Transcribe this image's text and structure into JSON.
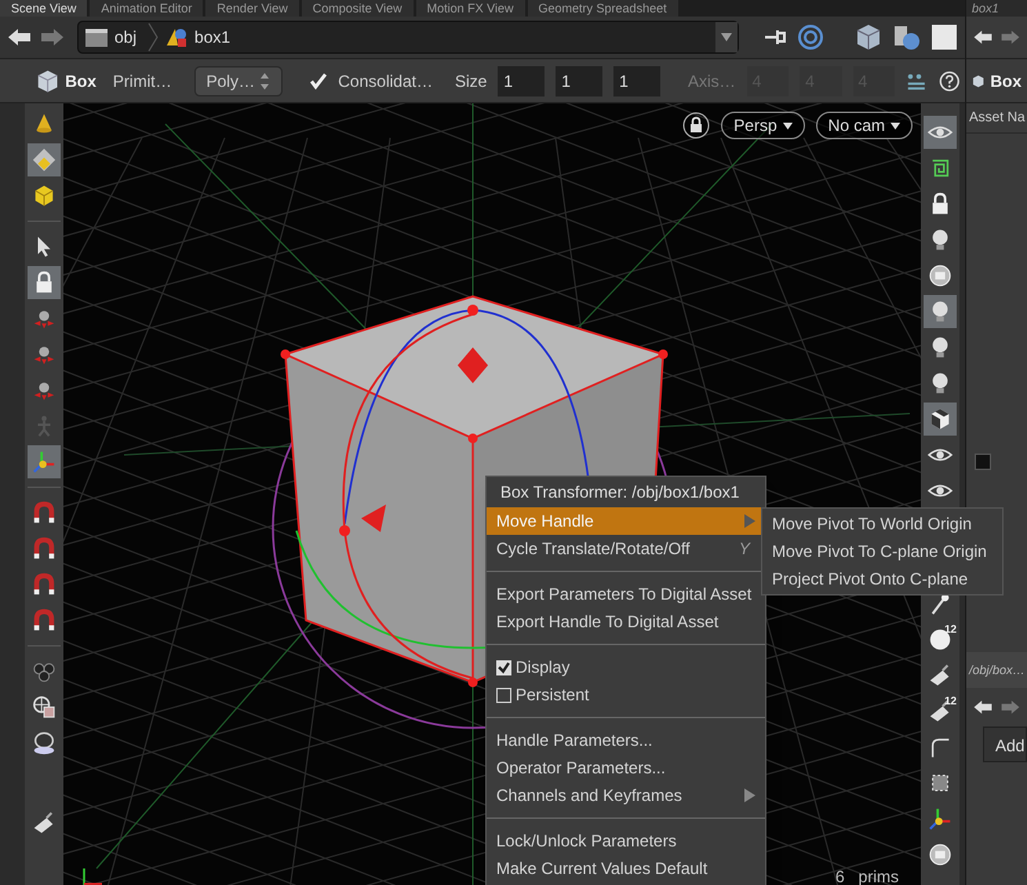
{
  "tabs": [
    {
      "label": "Scene View",
      "selected": true
    },
    {
      "label": "Animation Editor",
      "selected": false
    },
    {
      "label": "Render View",
      "selected": false
    },
    {
      "label": "Composite View",
      "selected": false
    },
    {
      "label": "Motion FX View",
      "selected": false
    },
    {
      "label": "Geometry Spreadsheet",
      "selected": false
    }
  ],
  "path": [
    "obj",
    "box1"
  ],
  "operator_bar": {
    "name": "Box",
    "primitive_label": "Primit…",
    "primitive_type": "Poly…",
    "consolidate": {
      "label": "Consolidat…",
      "checked": true
    },
    "size_label": "Size",
    "size": [
      "1",
      "1",
      "1"
    ],
    "axis_label": "Axis…",
    "axis": [
      "4",
      "4",
      "4"
    ]
  },
  "viewport": {
    "camera": "Persp",
    "cam_menu": "No cam",
    "status": "6   prims"
  },
  "left_tools": [
    {
      "kind": "cone",
      "selected": false
    },
    {
      "kind": "diamond",
      "selected": true
    },
    {
      "kind": "cube",
      "selected": false
    },
    {
      "kind": "separator"
    },
    {
      "kind": "arrow",
      "selected": false
    },
    {
      "kind": "lock",
      "selected": true
    },
    {
      "kind": "handle",
      "selected": false
    },
    {
      "kind": "handle",
      "selected": false
    },
    {
      "kind": "handle",
      "selected": false
    },
    {
      "kind": "figure",
      "selected": false
    },
    {
      "kind": "axes",
      "selected": true
    },
    {
      "kind": "separator"
    },
    {
      "kind": "magnet",
      "selected": false
    },
    {
      "kind": "magnet",
      "selected": false
    },
    {
      "kind": "magnet",
      "selected": false
    },
    {
      "kind": "magnet",
      "selected": false
    },
    {
      "kind": "separator"
    },
    {
      "kind": "cluster",
      "selected": false
    },
    {
      "kind": "target",
      "selected": false
    },
    {
      "kind": "lens",
      "selected": false
    },
    {
      "kind": "gap"
    },
    {
      "kind": "brush",
      "selected": false
    }
  ],
  "right_tools": [
    {
      "kind": "eye",
      "selected": true
    },
    {
      "kind": "spiral",
      "selected": false
    },
    {
      "kind": "lock",
      "selected": false
    },
    {
      "kind": "bulb",
      "selected": false
    },
    {
      "kind": "disc",
      "selected": false
    },
    {
      "kind": "bulb",
      "selected": true
    },
    {
      "kind": "bulb",
      "selected": false
    },
    {
      "kind": "bulb",
      "selected": false
    },
    {
      "kind": "checker",
      "selected": true
    },
    {
      "kind": "eye",
      "selected": false
    },
    {
      "kind": "eye",
      "selected": false
    },
    {
      "kind": "gap"
    },
    {
      "kind": "pin",
      "selected": false
    },
    {
      "kind": "dot",
      "selected": false,
      "label": "12"
    },
    {
      "kind": "brush",
      "selected": false
    },
    {
      "kind": "brush",
      "selected": false,
      "label": "12"
    },
    {
      "kind": "corner",
      "selected": false
    },
    {
      "kind": "grid",
      "selected": false
    },
    {
      "kind": "axes",
      "selected": false
    },
    {
      "kind": "disc",
      "selected": false
    }
  ],
  "menu": {
    "title": "Box Transformer: /obj/box1/box1",
    "items": [
      {
        "kind": "item",
        "label": "Move Handle",
        "selected": true,
        "submenu": true
      },
      {
        "kind": "item",
        "label": "Cycle Translate/Rotate/Off",
        "selected": false,
        "shortcut": "Y"
      },
      {
        "kind": "separator"
      },
      {
        "kind": "item",
        "label": "Export Parameters To Digital Asset",
        "selected": false
      },
      {
        "kind": "item",
        "label": "Export Handle To Digital Asset",
        "selected": false
      },
      {
        "kind": "separator"
      },
      {
        "kind": "check",
        "label": "Display",
        "checked": true,
        "selected": false
      },
      {
        "kind": "check",
        "label": "Persistent",
        "checked": false,
        "selected": false
      },
      {
        "kind": "separator"
      },
      {
        "kind": "item",
        "label": "Handle Parameters...",
        "selected": false
      },
      {
        "kind": "item",
        "label": "Operator Parameters...",
        "selected": false
      },
      {
        "kind": "item",
        "label": "Channels and Keyframes",
        "selected": false,
        "submenu": true
      },
      {
        "kind": "separator"
      },
      {
        "kind": "item",
        "label": "Lock/Unlock Parameters",
        "selected": false
      },
      {
        "kind": "item",
        "label": "Make Current Values Default",
        "selected": false
      }
    ],
    "submenu": [
      "Move Pivot To World Origin",
      "Move Pivot To C-plane Origin",
      "Project Pivot Onto C-plane"
    ]
  },
  "right_panel": {
    "title": "box1",
    "node": "Box",
    "asset_label": "Asset Na",
    "path": "/obj/box…",
    "add": "Add"
  }
}
